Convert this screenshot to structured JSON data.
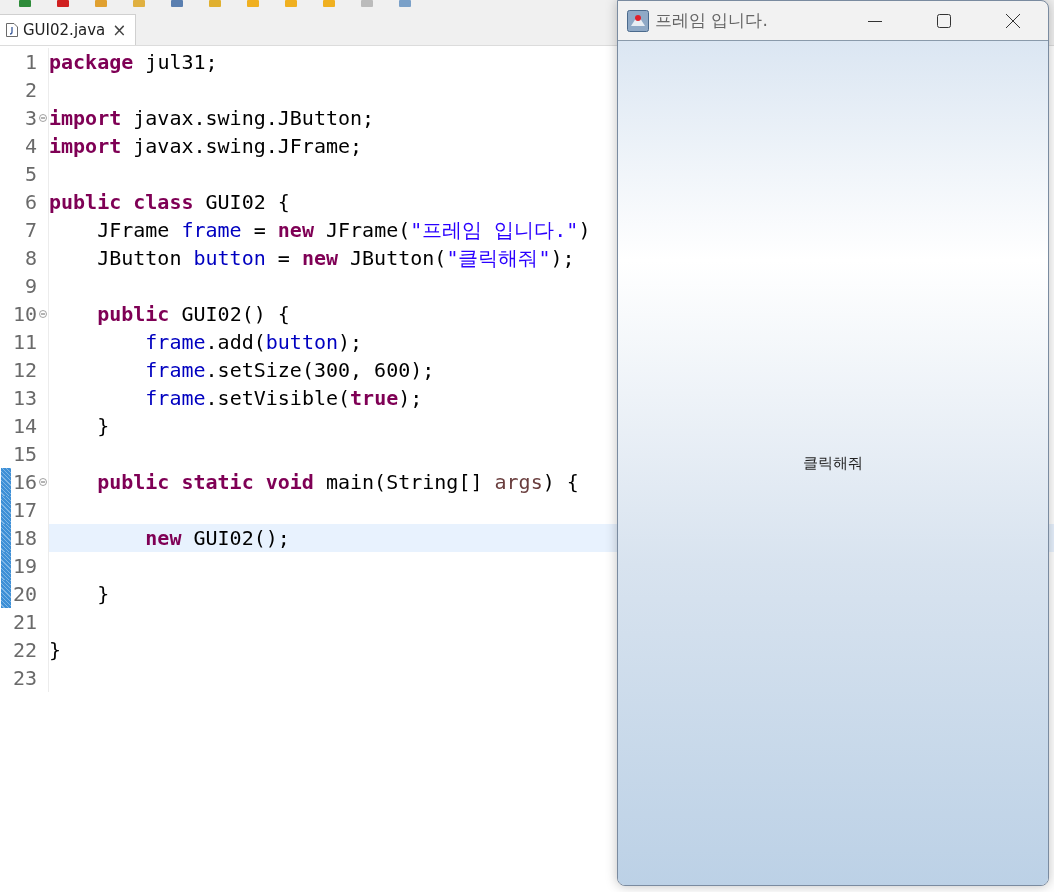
{
  "editor": {
    "tabs": [
      {
        "label": "GUI02.java",
        "selected": true,
        "close": "×"
      }
    ],
    "lines": [
      {
        "number": "1",
        "fold": false,
        "changed": false,
        "current": false,
        "tokens": [
          {
            "kind": "keyword",
            "text": "package"
          },
          {
            "kind": "plain",
            "text": " jul31;"
          }
        ]
      },
      {
        "number": "2",
        "fold": false,
        "changed": false,
        "current": false
      },
      {
        "number": "3",
        "fold": true,
        "changed": false,
        "current": false,
        "tokens": [
          {
            "kind": "keyword",
            "text": "import"
          },
          {
            "kind": "plain",
            "text": " javax.swing.JButton;"
          }
        ]
      },
      {
        "number": "4",
        "fold": false,
        "changed": false,
        "current": false,
        "tokens": [
          {
            "kind": "keyword",
            "text": "import"
          },
          {
            "kind": "plain",
            "text": " javax.swing.JFrame;"
          }
        ]
      },
      {
        "number": "5",
        "fold": false,
        "changed": false,
        "current": false
      },
      {
        "number": "6",
        "fold": false,
        "changed": false,
        "current": false,
        "tokens": [
          {
            "kind": "keyword",
            "text": "public class"
          },
          {
            "kind": "plain",
            "text": " GUI02 {"
          }
        ]
      },
      {
        "number": "7",
        "fold": false,
        "changed": false,
        "current": false,
        "tokens": [
          {
            "kind": "plain",
            "text": "    JFrame "
          },
          {
            "kind": "field",
            "text": "frame"
          },
          {
            "kind": "plain",
            "text": " = "
          },
          {
            "kind": "keyword",
            "text": "new"
          },
          {
            "kind": "plain",
            "text": " JFrame("
          },
          {
            "kind": "string",
            "text": "\"프레임 입니다.\""
          },
          {
            "kind": "plain",
            "text": ")"
          }
        ]
      },
      {
        "number": "8",
        "fold": false,
        "changed": false,
        "current": false,
        "tokens": [
          {
            "kind": "plain",
            "text": "    JButton "
          },
          {
            "kind": "field",
            "text": "button"
          },
          {
            "kind": "plain",
            "text": " = "
          },
          {
            "kind": "keyword",
            "text": "new"
          },
          {
            "kind": "plain",
            "text": " JButton("
          },
          {
            "kind": "string",
            "text": "\"클릭해줘\""
          },
          {
            "kind": "plain",
            "text": ");"
          }
        ]
      },
      {
        "number": "9",
        "fold": false,
        "changed": false,
        "current": false
      },
      {
        "number": "10",
        "fold": true,
        "changed": false,
        "current": false,
        "tokens": [
          {
            "kind": "keyword",
            "text": "    public"
          },
          {
            "kind": "plain",
            "text": " GUI02() {"
          }
        ]
      },
      {
        "number": "11",
        "fold": false,
        "changed": false,
        "current": false,
        "tokens": [
          {
            "kind": "field",
            "text": "        frame"
          },
          {
            "kind": "plain",
            "text": ".add("
          },
          {
            "kind": "field",
            "text": "button"
          },
          {
            "kind": "plain",
            "text": ");"
          }
        ]
      },
      {
        "number": "12",
        "fold": false,
        "changed": false,
        "current": false,
        "tokens": [
          {
            "kind": "field",
            "text": "        frame"
          },
          {
            "kind": "plain",
            "text": ".setSize(300, 600);"
          }
        ]
      },
      {
        "number": "13",
        "fold": false,
        "changed": false,
        "current": false,
        "tokens": [
          {
            "kind": "field",
            "text": "        frame"
          },
          {
            "kind": "plain",
            "text": ".setVisible("
          },
          {
            "kind": "keyword",
            "text": "true"
          },
          {
            "kind": "plain",
            "text": ");"
          }
        ]
      },
      {
        "number": "14",
        "fold": false,
        "changed": false,
        "current": false,
        "tokens": [
          {
            "kind": "plain",
            "text": "    }"
          }
        ]
      },
      {
        "number": "15",
        "fold": false,
        "changed": false,
        "current": false
      },
      {
        "number": "16",
        "fold": true,
        "changed": true,
        "current": false,
        "tokens": [
          {
            "kind": "keyword",
            "text": "    public static void"
          },
          {
            "kind": "plain",
            "text": " main(String[] "
          },
          {
            "kind": "param",
            "text": "args"
          },
          {
            "kind": "plain",
            "text": ") {"
          }
        ]
      },
      {
        "number": "17",
        "fold": false,
        "changed": true,
        "current": false
      },
      {
        "number": "18",
        "fold": false,
        "changed": true,
        "current": true,
        "tokens": [
          {
            "kind": "keyword",
            "text": "        new"
          },
          {
            "kind": "plain",
            "text": " GUI02();"
          }
        ]
      },
      {
        "number": "19",
        "fold": false,
        "changed": true,
        "current": false
      },
      {
        "number": "20",
        "fold": false,
        "changed": true,
        "current": false,
        "tokens": [
          {
            "kind": "plain",
            "text": "    }"
          }
        ]
      },
      {
        "number": "21",
        "fold": false,
        "changed": false,
        "current": false
      },
      {
        "number": "22",
        "fold": false,
        "changed": false,
        "current": false,
        "tokens": [
          {
            "kind": "plain",
            "text": "}"
          }
        ]
      },
      {
        "number": "23",
        "fold": false,
        "changed": false,
        "current": false
      }
    ]
  },
  "frame_window": {
    "title": "프레임 입니다.",
    "button": {
      "label": "클릭해줘"
    }
  }
}
